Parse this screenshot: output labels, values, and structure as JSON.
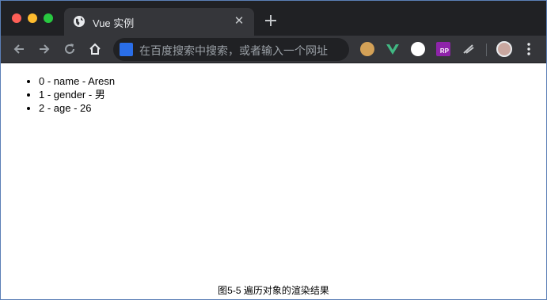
{
  "window": {
    "controls": [
      "close-light",
      "minimize-light",
      "maximize-light"
    ]
  },
  "tab": {
    "title": "Vue 实例",
    "close_label": "✕",
    "favicon": "globe-icon"
  },
  "toolbar": {
    "back": "back-arrow-icon",
    "forward": "forward-arrow-icon",
    "reload": "reload-icon",
    "home": "home-icon",
    "omnibox_placeholder": "在百度搜索中搜索，或者输入一个网址",
    "extensions": [
      "cookie-icon",
      "vue-devtools-icon",
      "circle-extension-icon",
      "rp-extension-icon",
      "pen-extension-icon"
    ],
    "rp_label": "RP",
    "menu": "more-vert-icon"
  },
  "page": {
    "list": [
      "0 - name - Aresn",
      "1 - gender - 男",
      "2 - age - 26"
    ]
  },
  "caption": "图5-5 遍历对象的渲染结果",
  "colors": {
    "titlebar": "#202124",
    "toolbar": "#35363a",
    "frame_border": "#5b7fb6",
    "vue_green": "#41b883"
  }
}
